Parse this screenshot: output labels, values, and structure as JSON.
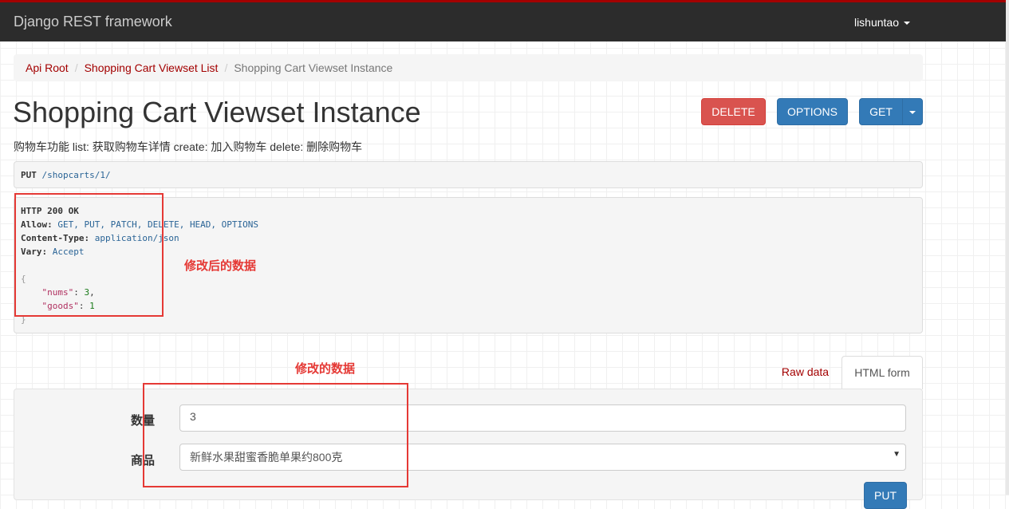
{
  "navbar": {
    "brand": "Django REST framework",
    "user": "lishuntao"
  },
  "breadcrumb": {
    "items": [
      "Api Root",
      "Shopping Cart Viewset List"
    ],
    "active": "Shopping Cart Viewset Instance"
  },
  "page": {
    "title": "Shopping Cart Viewset Instance",
    "description": "购物车功能 list: 获取购物车详情 create: 加入购物车 delete: 删除购物车"
  },
  "actions": {
    "delete": "DELETE",
    "options": "OPTIONS",
    "get": "GET"
  },
  "request": {
    "method": "PUT",
    "path": "/shopcarts/1/"
  },
  "response": {
    "status": "HTTP 200 OK",
    "allow_key": "Allow:",
    "allow_val": "GET, PUT, PATCH, DELETE, HEAD, OPTIONS",
    "ctype_key": "Content-Type:",
    "ctype_val": "application/json",
    "vary_key": "Vary:",
    "vary_val": "Accept",
    "body_open": "{",
    "nums_key": "\"nums\"",
    "nums_val": "3",
    "goods_key": "\"goods\"",
    "goods_val": "1",
    "body_close": "}"
  },
  "annotations": {
    "modified_data": "修改后的数据",
    "edit_data": "修改的数据"
  },
  "tabs": {
    "raw": "Raw data",
    "html": "HTML form"
  },
  "form": {
    "nums_label": "数量",
    "nums_value": "3",
    "goods_label": "商品",
    "goods_value": "新鲜水果甜蜜香脆单果约800克",
    "submit": "PUT"
  },
  "colors": {
    "navbar": "#2c2c2c",
    "accent": "#a30000",
    "danger": "#d9534f",
    "primary": "#337ab7",
    "annotation": "#e53935"
  }
}
